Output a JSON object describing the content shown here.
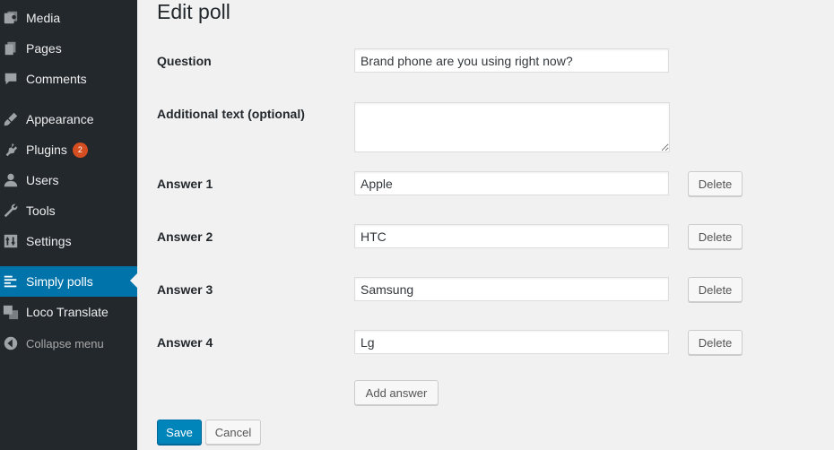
{
  "sidebar": {
    "items": [
      {
        "label": "Media",
        "icon": "media-icon"
      },
      {
        "label": "Pages",
        "icon": "pages-icon"
      },
      {
        "label": "Comments",
        "icon": "comments-icon"
      },
      {
        "label": "Appearance",
        "icon": "appearance-icon"
      },
      {
        "label": "Plugins",
        "icon": "plugins-icon",
        "badge": "2"
      },
      {
        "label": "Users",
        "icon": "users-icon"
      },
      {
        "label": "Tools",
        "icon": "tools-icon"
      },
      {
        "label": "Settings",
        "icon": "settings-icon"
      },
      {
        "label": "Simply polls",
        "icon": "simply-polls-icon",
        "active": true
      },
      {
        "label": "Loco Translate",
        "icon": "translate-icon"
      }
    ],
    "collapse_label": "Collapse menu"
  },
  "page": {
    "title": "Edit poll",
    "question_label": "Question",
    "question_value": "Brand phone are you using right now?",
    "additional_label": "Additional text (optional)",
    "additional_value": "",
    "answers": [
      {
        "label": "Answer 1",
        "value": "Apple",
        "delete_label": "Delete"
      },
      {
        "label": "Answer 2",
        "value": "HTC",
        "delete_label": "Delete"
      },
      {
        "label": "Answer 3",
        "value": "Samsung",
        "delete_label": "Delete"
      },
      {
        "label": "Answer 4",
        "value": "Lg",
        "delete_label": "Delete"
      }
    ],
    "add_answer_label": "Add answer",
    "save_label": "Save",
    "cancel_label": "Cancel"
  },
  "colors": {
    "sidebar_bg": "#23282d",
    "active_bg": "#0073aa",
    "primary_button": "#0085ba",
    "badge": "#d54e21"
  }
}
